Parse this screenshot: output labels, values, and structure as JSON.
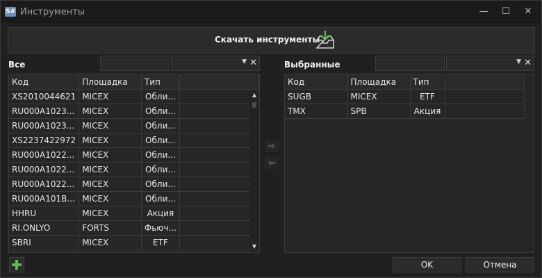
{
  "window": {
    "title": "Инструменты",
    "app_icon_text": "S#",
    "minimize": "—",
    "maximize": "☐",
    "close": "✕"
  },
  "download": {
    "label": "Скачать инструменты",
    "icon": "tray-download-icon"
  },
  "left_panel": {
    "title": "Все",
    "columns": [
      "Код",
      "Площадка",
      "Тип"
    ],
    "rows": [
      [
        "XS2010044621",
        "MICEX",
        "Обли..."
      ],
      [
        "RU000A1023...",
        "MICEX",
        "Обли..."
      ],
      [
        "RU000A1023...",
        "MICEX",
        "Обли..."
      ],
      [
        "XS2237422972",
        "MICEX",
        "Обли..."
      ],
      [
        "RU000A1022...",
        "MICEX",
        "Обли..."
      ],
      [
        "RU000A1022...",
        "MICEX",
        "Обли..."
      ],
      [
        "RU000A1022...",
        "MICEX",
        "Обли..."
      ],
      [
        "RU000A101B...",
        "MICEX",
        "Обли..."
      ],
      [
        "HHRU",
        "MICEX",
        "Акция"
      ],
      [
        "RI.ONLYO",
        "FORTS",
        "Фьюч..."
      ],
      [
        "SBRI",
        "MICEX",
        "ETF"
      ]
    ]
  },
  "right_panel": {
    "title": "Выбранные",
    "columns": [
      "Код",
      "Площадка",
      "Тип"
    ],
    "rows": [
      [
        "SUGB",
        "MICEX",
        "ETF"
      ],
      [
        "TMX",
        "SPB",
        "Акция"
      ]
    ]
  },
  "move": {
    "add_arrow": "⇨",
    "remove_arrow": "⇦"
  },
  "footer": {
    "ok_label": "OK",
    "cancel_label": "Отмена"
  },
  "colors": {
    "accent_green": "#5bbf4b",
    "background": "#202020",
    "border": "#3b3b3b"
  }
}
